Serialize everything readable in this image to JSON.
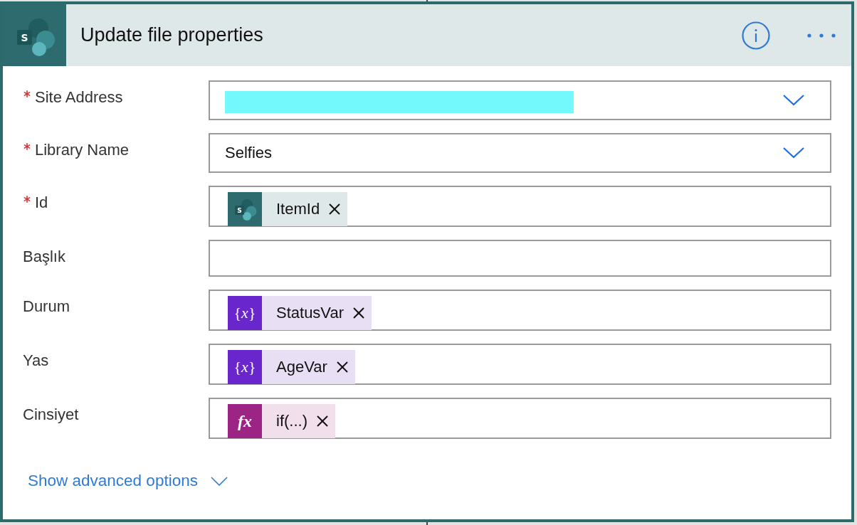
{
  "card": {
    "header": {
      "icon_text": "S",
      "title": "Update file properties"
    },
    "fields": [
      {
        "label": "Site Address",
        "required": true,
        "kind": "dropdown",
        "redacted": true
      },
      {
        "label": "Library Name",
        "required": true,
        "kind": "dropdown",
        "value": "Selfies"
      },
      {
        "label": "Id",
        "required": true,
        "kind": "tokens",
        "tokens": [
          {
            "kind": "sharepoint",
            "icon_text": "S",
            "label": "ItemId"
          }
        ]
      },
      {
        "label": "Başlık",
        "required": false,
        "kind": "text"
      },
      {
        "label": "Durum",
        "required": false,
        "kind": "tokens",
        "tokens": [
          {
            "kind": "variable",
            "icon_text": "{*x*}",
            "label": "StatusVar"
          }
        ]
      },
      {
        "label": "Yas",
        "required": false,
        "kind": "tokens",
        "tokens": [
          {
            "kind": "variable",
            "icon_text": "{*x*}",
            "label": "AgeVar"
          }
        ]
      },
      {
        "label": "Cinsiyet",
        "required": false,
        "kind": "tokens",
        "tokens": [
          {
            "kind": "expression",
            "icon_text": "fx",
            "label": "if(...)"
          }
        ]
      }
    ],
    "advanced_link": "Show advanced options"
  }
}
